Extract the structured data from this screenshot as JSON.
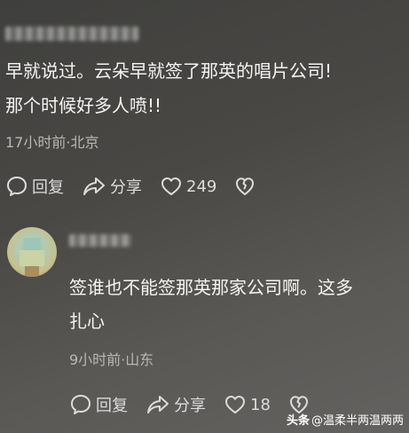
{
  "comment1": {
    "text_line1": "早就说过。云朵早就签了那英的唱片公司!",
    "text_line2": "那个时候好多人喷!!",
    "meta": "17小时前·北京",
    "reply_label": "回复",
    "share_label": "分享",
    "like_count": "249"
  },
  "comment2": {
    "text_line1": "签谁也不能签那英那家公司啊。这多",
    "text_line2": "扎心",
    "meta": "9小时前·山东",
    "reply_label": "回复",
    "share_label": "分享",
    "like_count": "18"
  },
  "watermark": {
    "brand": "头条",
    "handle": "@温柔半两温两两"
  },
  "colors": {
    "text": "#f4f4f4",
    "meta": "#b9b7b4",
    "icon": "#dcdcdc"
  },
  "icons": [
    "reply-icon",
    "share-icon",
    "heart-icon",
    "broken-heart-icon"
  ]
}
